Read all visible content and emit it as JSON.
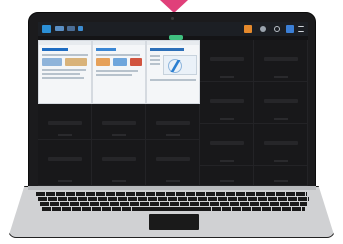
{
  "colors": {
    "accent": "#e0407a",
    "bezel": "#1b1b1d",
    "screen_bg": "#141416",
    "taskbar": "#1c1f24"
  },
  "topbar": {
    "icons": [
      "app-logo-icon",
      "bell-icon",
      "user-icon",
      "gear-icon",
      "avatar-icon",
      "menu-icon"
    ]
  },
  "windows": [
    {
      "label": "",
      "kind": "website"
    },
    {
      "label": "",
      "kind": "website"
    },
    {
      "label": "",
      "kind": "map"
    }
  ],
  "grid": {
    "columns": 5,
    "rows": 4,
    "active_tiles": 3
  }
}
